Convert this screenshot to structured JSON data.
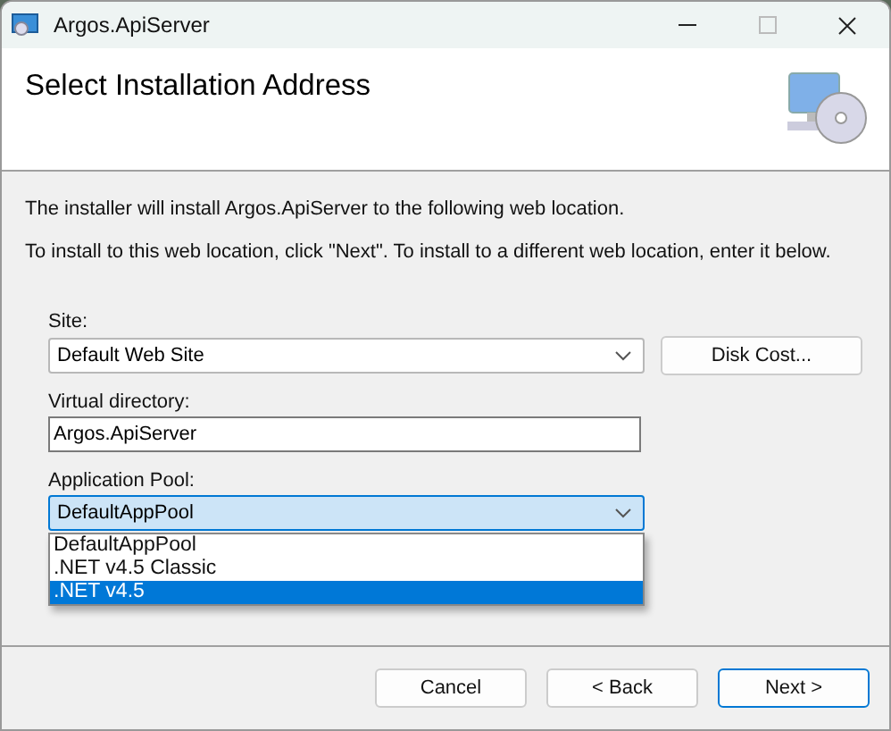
{
  "window": {
    "title": "Argos.ApiServer"
  },
  "header": {
    "title": "Select Installation Address"
  },
  "intro": [
    "The installer will install Argos.ApiServer to the following web location.",
    "To install to this web location, click \"Next\". To install to a different web location, enter it below."
  ],
  "site": {
    "label": "Site:",
    "value": "Default Web Site",
    "button": "Disk Cost..."
  },
  "virtual_directory": {
    "label": "Virtual directory:",
    "value": "Argos.ApiServer"
  },
  "application_pool": {
    "label": "Application Pool:",
    "value": "DefaultAppPool",
    "expanded": true,
    "options": [
      {
        "label": "DefaultAppPool",
        "highlighted": false
      },
      {
        "label": ".NET v4.5 Classic",
        "highlighted": false
      },
      {
        "label": ".NET v4.5",
        "highlighted": true
      }
    ]
  },
  "buttons": [
    {
      "label": "Cancel",
      "default": false
    },
    {
      "label": "< Back",
      "default": false
    },
    {
      "label": "Next >",
      "default": true
    }
  ]
}
